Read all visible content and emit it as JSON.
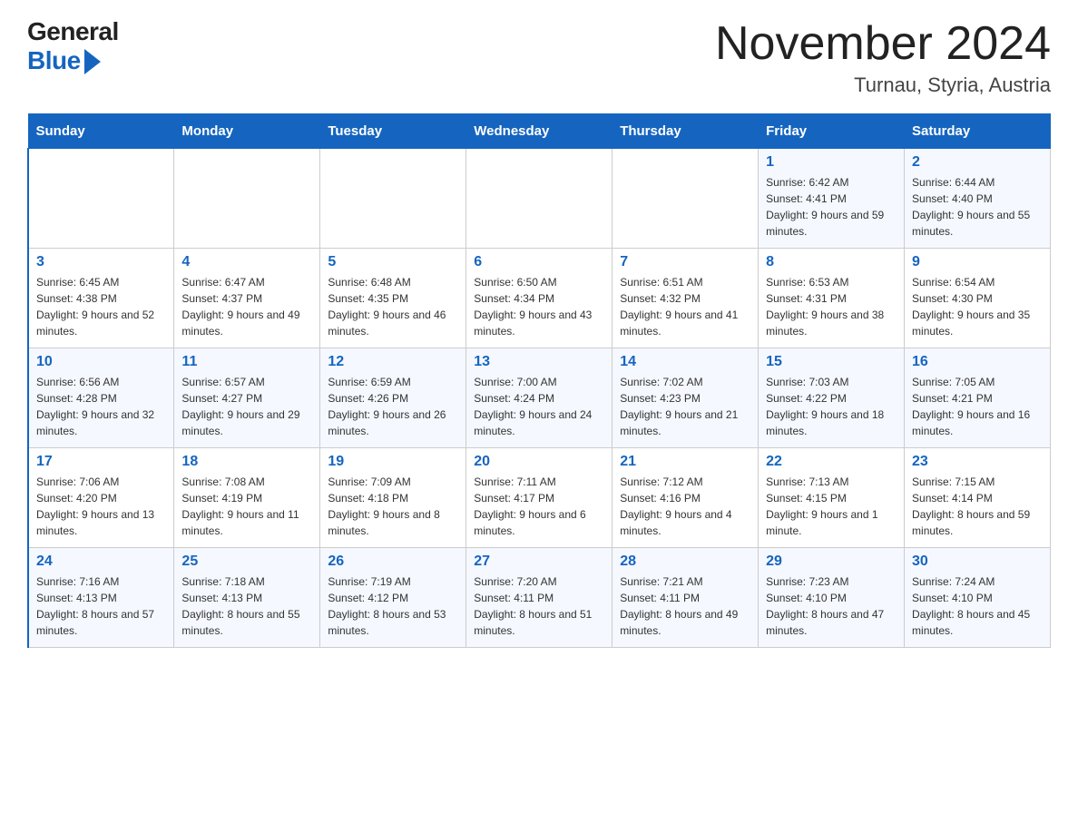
{
  "logo": {
    "text1": "General",
    "text2": "Blue"
  },
  "title": "November 2024",
  "subtitle": "Turnau, Styria, Austria",
  "days_of_week": [
    "Sunday",
    "Monday",
    "Tuesday",
    "Wednesday",
    "Thursday",
    "Friday",
    "Saturday"
  ],
  "weeks": [
    [
      {
        "day": "",
        "info": ""
      },
      {
        "day": "",
        "info": ""
      },
      {
        "day": "",
        "info": ""
      },
      {
        "day": "",
        "info": ""
      },
      {
        "day": "",
        "info": ""
      },
      {
        "day": "1",
        "info": "Sunrise: 6:42 AM\nSunset: 4:41 PM\nDaylight: 9 hours and 59 minutes."
      },
      {
        "day": "2",
        "info": "Sunrise: 6:44 AM\nSunset: 4:40 PM\nDaylight: 9 hours and 55 minutes."
      }
    ],
    [
      {
        "day": "3",
        "info": "Sunrise: 6:45 AM\nSunset: 4:38 PM\nDaylight: 9 hours and 52 minutes."
      },
      {
        "day": "4",
        "info": "Sunrise: 6:47 AM\nSunset: 4:37 PM\nDaylight: 9 hours and 49 minutes."
      },
      {
        "day": "5",
        "info": "Sunrise: 6:48 AM\nSunset: 4:35 PM\nDaylight: 9 hours and 46 minutes."
      },
      {
        "day": "6",
        "info": "Sunrise: 6:50 AM\nSunset: 4:34 PM\nDaylight: 9 hours and 43 minutes."
      },
      {
        "day": "7",
        "info": "Sunrise: 6:51 AM\nSunset: 4:32 PM\nDaylight: 9 hours and 41 minutes."
      },
      {
        "day": "8",
        "info": "Sunrise: 6:53 AM\nSunset: 4:31 PM\nDaylight: 9 hours and 38 minutes."
      },
      {
        "day": "9",
        "info": "Sunrise: 6:54 AM\nSunset: 4:30 PM\nDaylight: 9 hours and 35 minutes."
      }
    ],
    [
      {
        "day": "10",
        "info": "Sunrise: 6:56 AM\nSunset: 4:28 PM\nDaylight: 9 hours and 32 minutes."
      },
      {
        "day": "11",
        "info": "Sunrise: 6:57 AM\nSunset: 4:27 PM\nDaylight: 9 hours and 29 minutes."
      },
      {
        "day": "12",
        "info": "Sunrise: 6:59 AM\nSunset: 4:26 PM\nDaylight: 9 hours and 26 minutes."
      },
      {
        "day": "13",
        "info": "Sunrise: 7:00 AM\nSunset: 4:24 PM\nDaylight: 9 hours and 24 minutes."
      },
      {
        "day": "14",
        "info": "Sunrise: 7:02 AM\nSunset: 4:23 PM\nDaylight: 9 hours and 21 minutes."
      },
      {
        "day": "15",
        "info": "Sunrise: 7:03 AM\nSunset: 4:22 PM\nDaylight: 9 hours and 18 minutes."
      },
      {
        "day": "16",
        "info": "Sunrise: 7:05 AM\nSunset: 4:21 PM\nDaylight: 9 hours and 16 minutes."
      }
    ],
    [
      {
        "day": "17",
        "info": "Sunrise: 7:06 AM\nSunset: 4:20 PM\nDaylight: 9 hours and 13 minutes."
      },
      {
        "day": "18",
        "info": "Sunrise: 7:08 AM\nSunset: 4:19 PM\nDaylight: 9 hours and 11 minutes."
      },
      {
        "day": "19",
        "info": "Sunrise: 7:09 AM\nSunset: 4:18 PM\nDaylight: 9 hours and 8 minutes."
      },
      {
        "day": "20",
        "info": "Sunrise: 7:11 AM\nSunset: 4:17 PM\nDaylight: 9 hours and 6 minutes."
      },
      {
        "day": "21",
        "info": "Sunrise: 7:12 AM\nSunset: 4:16 PM\nDaylight: 9 hours and 4 minutes."
      },
      {
        "day": "22",
        "info": "Sunrise: 7:13 AM\nSunset: 4:15 PM\nDaylight: 9 hours and 1 minute."
      },
      {
        "day": "23",
        "info": "Sunrise: 7:15 AM\nSunset: 4:14 PM\nDaylight: 8 hours and 59 minutes."
      }
    ],
    [
      {
        "day": "24",
        "info": "Sunrise: 7:16 AM\nSunset: 4:13 PM\nDaylight: 8 hours and 57 minutes."
      },
      {
        "day": "25",
        "info": "Sunrise: 7:18 AM\nSunset: 4:13 PM\nDaylight: 8 hours and 55 minutes."
      },
      {
        "day": "26",
        "info": "Sunrise: 7:19 AM\nSunset: 4:12 PM\nDaylight: 8 hours and 53 minutes."
      },
      {
        "day": "27",
        "info": "Sunrise: 7:20 AM\nSunset: 4:11 PM\nDaylight: 8 hours and 51 minutes."
      },
      {
        "day": "28",
        "info": "Sunrise: 7:21 AM\nSunset: 4:11 PM\nDaylight: 8 hours and 49 minutes."
      },
      {
        "day": "29",
        "info": "Sunrise: 7:23 AM\nSunset: 4:10 PM\nDaylight: 8 hours and 47 minutes."
      },
      {
        "day": "30",
        "info": "Sunrise: 7:24 AM\nSunset: 4:10 PM\nDaylight: 8 hours and 45 minutes."
      }
    ]
  ]
}
